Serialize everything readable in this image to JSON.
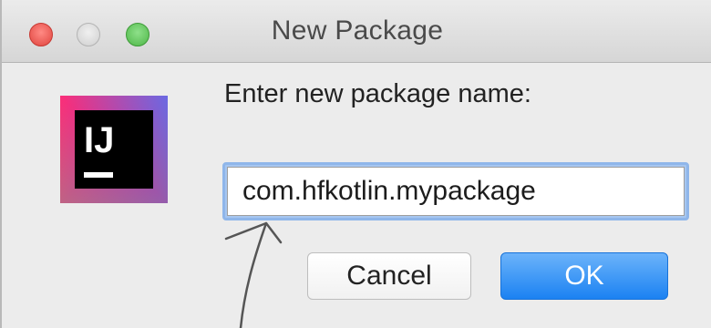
{
  "window": {
    "title": "New Package",
    "controls": [
      "close",
      "minimize",
      "zoom"
    ]
  },
  "logo": {
    "text": "IJ",
    "icon": "intellij-idea-icon"
  },
  "dialog": {
    "prompt": "Enter new package name:",
    "package_name_value": "com.hfkotlin.mypackage"
  },
  "buttons": {
    "cancel_label": "Cancel",
    "ok_label": "OK"
  },
  "colors": {
    "ok_button": "#1b82f2",
    "focus_ring": "#8fb6ea",
    "close_light": "#e0443e",
    "zoom_light": "#4fb748"
  }
}
